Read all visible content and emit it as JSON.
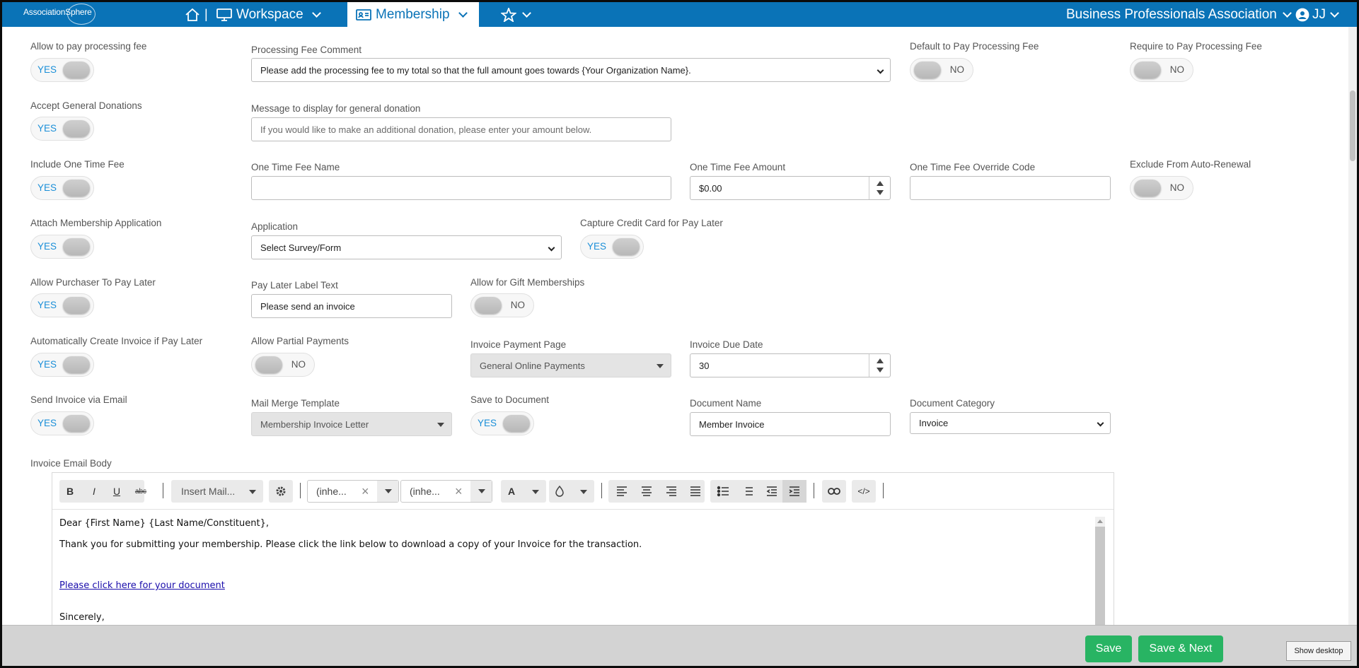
{
  "nav": {
    "logo": "AssociationSphere",
    "home_sep": "|",
    "workspace": "Workspace",
    "membership": "Membership",
    "org": "Business Professionals Association",
    "user": "JJ"
  },
  "form": {
    "allow_fee": {
      "label": "Allow to pay processing fee",
      "value": "YES"
    },
    "fee_comment": {
      "label": "Processing Fee Comment",
      "value": "Please add the processing fee to my total so that the full amount goes towards {Your Organization Name}."
    },
    "default_fee": {
      "label": "Default to Pay Processing Fee",
      "value": "NO"
    },
    "require_fee": {
      "label": "Require to Pay Processing Fee",
      "value": "NO"
    },
    "accept_donations": {
      "label": "Accept General Donations",
      "value": "YES"
    },
    "donation_msg": {
      "label": "Message to display for general donation",
      "placeholder": "If you would like to make an additional donation, please enter your amount below."
    },
    "one_time_fee": {
      "label": "Include One Time Fee",
      "value": "YES"
    },
    "fee_name": {
      "label": "One Time Fee Name",
      "value": ""
    },
    "fee_amount": {
      "label": "One Time Fee Amount",
      "value": "$0.00"
    },
    "override_code": {
      "label": "One Time Fee Override Code",
      "value": ""
    },
    "exclude_renewal": {
      "label": "Exclude From Auto-Renewal",
      "value": "NO"
    },
    "attach_app": {
      "label": "Attach Membership Application",
      "value": "YES"
    },
    "application": {
      "label": "Application",
      "value": "Select Survey/Form"
    },
    "capture_cc": {
      "label": "Capture Credit Card for Pay Later",
      "value": "YES"
    },
    "pay_later": {
      "label": "Allow Purchaser To Pay Later",
      "value": "YES"
    },
    "pay_later_label": {
      "label": "Pay Later Label Text",
      "value": "Please send an invoice"
    },
    "gift": {
      "label": "Allow for Gift Memberships",
      "value": "NO"
    },
    "auto_invoice": {
      "label": "Automatically Create Invoice if Pay Later",
      "value": "YES"
    },
    "partial": {
      "label": "Allow Partial Payments",
      "value": "NO"
    },
    "payment_page": {
      "label": "Invoice Payment Page",
      "value": "General Online Payments"
    },
    "due_date": {
      "label": "Invoice Due Date",
      "value": "30"
    },
    "send_email": {
      "label": "Send Invoice via Email",
      "value": "YES"
    },
    "mail_merge": {
      "label": "Mail Merge Template",
      "value": "Membership Invoice Letter"
    },
    "save_doc": {
      "label": "Save to Document",
      "value": "YES"
    },
    "doc_name": {
      "label": "Document Name",
      "value": "Member Invoice"
    },
    "doc_category": {
      "label": "Document Category",
      "value": "Invoice"
    },
    "email_body_label": "Invoice Email Body"
  },
  "editor": {
    "bold": "B",
    "italic": "I",
    "underline": "U",
    "strike": "abc",
    "insert_mail": "Insert Mail...",
    "font1": "(inhe...",
    "font2": "(inhe...",
    "color": "A",
    "line1": "Dear {First Name} {Last Name/Constituent},",
    "line2": "Thank you for submitting your membership. Please click the link below to download a copy of your Invoice for the transaction.",
    "link": "Please click here for your document",
    "line3": "Sincerely,"
  },
  "footer": {
    "save": "Save",
    "save_next": "Save & Next",
    "show_desktop": "Show desktop"
  },
  "colors": {
    "brand": "#0a73b7",
    "yes_text": "#1b8fd8",
    "save_btn": "#28b463"
  }
}
